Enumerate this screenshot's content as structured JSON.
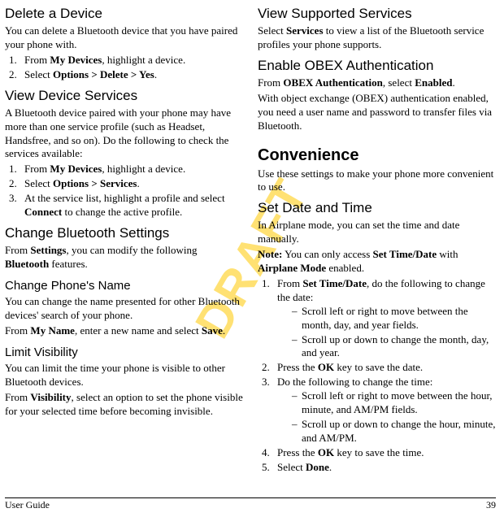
{
  "watermark": "DRAFT",
  "left": {
    "h2a": "Delete a Device",
    "p1": "You can delete a Bluetooth device that you have paired your phone with.",
    "ol1_1a": "From ",
    "ol1_1b": "My Devices",
    "ol1_1c": ", highlight a device.",
    "ol1_2a": "Select ",
    "ol1_2b": "Options > Delete > Yes",
    "ol1_2c": ".",
    "h2b": "View Device Services",
    "p2": "A Bluetooth device paired with your phone may have more than one service profile (such as Headset, Handsfree, and so on). Do the following to check the services available:",
    "ol2_1a": "From ",
    "ol2_1b": "My Devices",
    "ol2_1c": ", highlight a device.",
    "ol2_2a": "Select ",
    "ol2_2b": "Options > Services",
    "ol2_2c": ".",
    "ol2_3a": "At the service list, highlight a profile and select ",
    "ol2_3b": "Connect",
    "ol2_3c": " to change the active profile.",
    "h2c": "Change Bluetooth Settings",
    "p3a": "From ",
    "p3b": "Settings",
    "p3c": ", you can modify the following ",
    "p3d": "Bluetooth",
    "p3e": " features.",
    "h3a": "Change Phone's Name",
    "p4": "You can change the name presented for other Bluetooth devices' search of your phone.",
    "p5a": "From ",
    "p5b": "My Name",
    "p5c": ", enter a new name and select ",
    "p5d": "Save",
    "p5e": ".",
    "h3b": "Limit Visibility",
    "p6": "You can limit the time your phone is visible to other Bluetooth devices.",
    "p7a": "From ",
    "p7b": "Visibility",
    "p7c": ", select an option to set the phone visible for your selected time before becoming invisible."
  },
  "right": {
    "h2a": "View Supported Services",
    "p1a": "Select ",
    "p1b": "Services",
    "p1c": " to view a list of the Bluetooth service profiles your phone supports.",
    "h2b": "Enable OBEX Authentication",
    "p2a": "From ",
    "p2b": "OBEX Authentication",
    "p2c": ", select ",
    "p2d": "Enabled",
    "p2e": ".",
    "p3": "With object exchange (OBEX) authentication enabled, you need a user name and password to transfer files via Bluetooth.",
    "h1": "Convenience",
    "p4": "Use these settings to make your phone more convenient to use.",
    "h2c": "Set Date and Time",
    "p5": "In Airplane mode, you can set the time and date manually.",
    "p6a": "Note:",
    "p6b": " You can only access ",
    "p6c": "Set Time/Date",
    "p6d": " with ",
    "p6e": "Airplane Mode",
    "p6f": " enabled.",
    "ol_1a": "From ",
    "ol_1b": "Set Time/Date",
    "ol_1c": ", do the following to change the date:",
    "ol_1_d1": "Scroll left or right to move between the month, day, and year fields.",
    "ol_1_d2": "Scroll up or down to change the month, day, and year.",
    "ol_2a": "Press the ",
    "ol_2b": "OK",
    "ol_2c": " key to save the date.",
    "ol_3": "Do the following to change the time:",
    "ol_3_d1": "Scroll left or right to move between the hour, minute, and AM/PM fields.",
    "ol_3_d2": "Scroll up or down to change the hour, minute, and AM/PM.",
    "ol_4a": "Press the ",
    "ol_4b": "OK",
    "ol_4c": " key to save the time.",
    "ol_5a": "Select ",
    "ol_5b": "Done",
    "ol_5c": "."
  },
  "footer": {
    "left": "User Guide",
    "right": "39"
  }
}
